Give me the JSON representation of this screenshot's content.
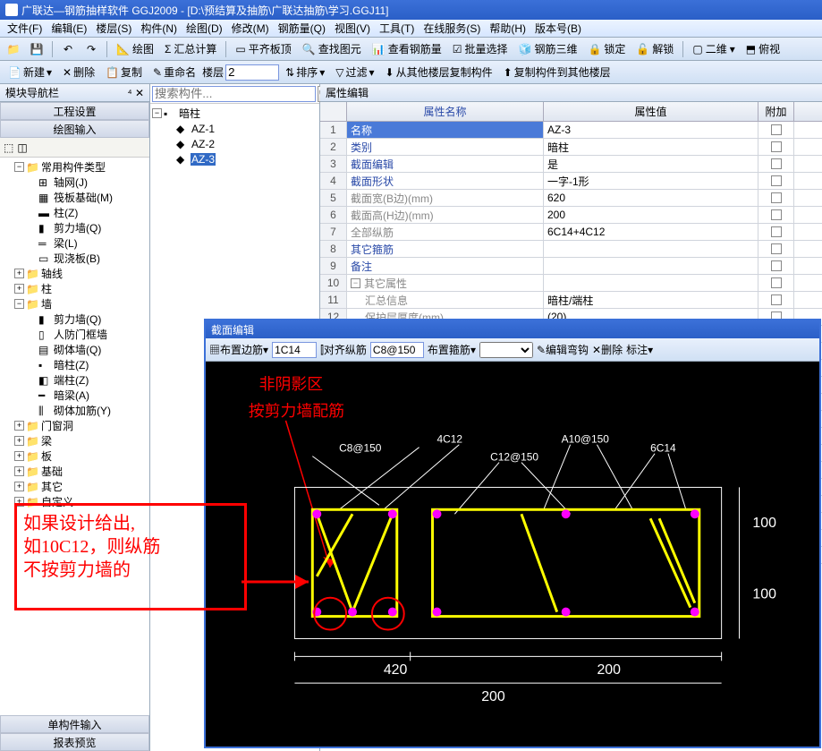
{
  "title": "广联达—钢筋抽样软件 GGJ2009 - [D:\\预结算及抽筋\\广联达抽筋\\学习.GGJ11]",
  "menus": [
    "文件(F)",
    "编辑(E)",
    "楼层(S)",
    "构件(N)",
    "绘图(D)",
    "修改(M)",
    "钢筋量(Q)",
    "视图(V)",
    "工具(T)",
    "在线服务(S)",
    "帮助(H)",
    "版本号(B)"
  ],
  "tb1": {
    "draw": "绘图",
    "summary": "汇总计算",
    "flat": "平齐板顶",
    "find": "查找图元",
    "view_rebar": "查看钢筋量",
    "batch": "批量选择",
    "tri3d": "钢筋三维",
    "lock": "锁定",
    "unlock": "解锁",
    "two_d": "二维",
    "bird": "俯视"
  },
  "tb2": {
    "new": "新建",
    "del": "删除",
    "copy": "复制",
    "rename": "重命名",
    "floor_lbl": "楼层",
    "floor_val": "2",
    "sort": "排序",
    "filter": "过滤",
    "copy_from": "从其他楼层复制构件",
    "copy_to": "复制构件到其他楼层"
  },
  "nav_title": "模块导航栏",
  "accordion": {
    "proj": "工程设置",
    "draw": "绘图输入",
    "single": "单构件输入",
    "report": "报表预览"
  },
  "tree": [
    {
      "lbl": "常用构件类型",
      "exp": "−",
      "ind": 1,
      "ic": "folder"
    },
    {
      "lbl": "轴网(J)",
      "ind": 2,
      "ic": "grid"
    },
    {
      "lbl": "筏板基础(M)",
      "ind": 2,
      "ic": "raft"
    },
    {
      "lbl": "柱(Z)",
      "ind": 2,
      "ic": "col"
    },
    {
      "lbl": "剪力墙(Q)",
      "ind": 2,
      "ic": "wall"
    },
    {
      "lbl": "梁(L)",
      "ind": 2,
      "ic": "beam"
    },
    {
      "lbl": "现浇板(B)",
      "ind": 2,
      "ic": "slab"
    },
    {
      "lbl": "轴线",
      "exp": "+",
      "ind": 1,
      "ic": "folder"
    },
    {
      "lbl": "柱",
      "exp": "+",
      "ind": 1,
      "ic": "folder"
    },
    {
      "lbl": "墙",
      "exp": "−",
      "ind": 1,
      "ic": "folder"
    },
    {
      "lbl": "剪力墙(Q)",
      "ind": 2,
      "ic": "wall"
    },
    {
      "lbl": "人防门框墙",
      "ind": 2,
      "ic": "wall2"
    },
    {
      "lbl": "砌体墙(Q)",
      "ind": 2,
      "ic": "wall3"
    },
    {
      "lbl": "暗柱(Z)",
      "ind": 2,
      "ic": "hcol",
      "sel": true
    },
    {
      "lbl": "端柱(Z)",
      "ind": 2,
      "ic": "ecol"
    },
    {
      "lbl": "暗梁(A)",
      "ind": 2,
      "ic": "hbeam"
    },
    {
      "lbl": "砌体加筋(Y)",
      "ind": 2,
      "ic": "mrebar"
    },
    {
      "lbl": "门窗洞",
      "exp": "+",
      "ind": 1,
      "ic": "folder"
    },
    {
      "lbl": "梁",
      "exp": "+",
      "ind": 1,
      "ic": "folder"
    },
    {
      "lbl": "板",
      "exp": "+",
      "ind": 1,
      "ic": "folder"
    },
    {
      "lbl": "基础",
      "exp": "+",
      "ind": 1,
      "ic": "folder"
    },
    {
      "lbl": "其它",
      "exp": "+",
      "ind": 1,
      "ic": "folder"
    },
    {
      "lbl": "自定义",
      "exp": "+",
      "ind": 1,
      "ic": "folder"
    }
  ],
  "search_ph": "搜索构件...",
  "subtree": {
    "root": "暗柱",
    "items": [
      "AZ-1",
      "AZ-2",
      "AZ-3"
    ],
    "sel": "AZ-3"
  },
  "prop_title": "属性编辑",
  "prop_hdr": {
    "name": "属性名称",
    "val": "属性值",
    "add": "附加"
  },
  "props": [
    {
      "i": 1,
      "n": "名称",
      "v": "AZ-3",
      "sel": true
    },
    {
      "i": 2,
      "n": "类别",
      "v": "暗柱"
    },
    {
      "i": 3,
      "n": "截面编辑",
      "v": "是"
    },
    {
      "i": 4,
      "n": "截面形状",
      "v": "一字-1形"
    },
    {
      "i": 5,
      "n": "截面宽(B边)(mm)",
      "v": "620",
      "g": true
    },
    {
      "i": 6,
      "n": "截面高(H边)(mm)",
      "v": "200",
      "g": true
    },
    {
      "i": 7,
      "n": "全部纵筋",
      "v": "6C14+4C12",
      "g": true
    },
    {
      "i": 8,
      "n": "其它箍筋",
      "v": ""
    },
    {
      "i": 9,
      "n": "备注",
      "v": ""
    },
    {
      "i": 10,
      "n": "其它属性",
      "v": "",
      "exp": "−",
      "g": true
    },
    {
      "i": 11,
      "n": "汇总信息",
      "v": "暗柱/端柱",
      "g": true,
      "sub": true
    },
    {
      "i": 12,
      "n": "保护层厚度(mm)",
      "v": "(20)",
      "g": true,
      "sub": true
    }
  ],
  "se_title": "截面编辑",
  "se_tb": {
    "edge": "布置边筋",
    "edge_val": "1C14",
    "align": "对齐纵筋",
    "stir_val": "C8@150",
    "stir": "布置箍筋",
    "hook": "编辑弯钩",
    "del": "删除",
    "note": "标注"
  },
  "annot": {
    "t1": "非阴影区",
    "t2": "按剪力墙配筋",
    "box": "如果设计给出,\n如10C12，则纵筋\n不按剪力墙的"
  },
  "dims": {
    "a": "C8@150",
    "b": "4C12",
    "c": "C12@150",
    "d": "A10@150",
    "e": "6C14",
    "w1": "420",
    "w2": "200",
    "w3": "200",
    "h1": "100",
    "h2": "100"
  }
}
